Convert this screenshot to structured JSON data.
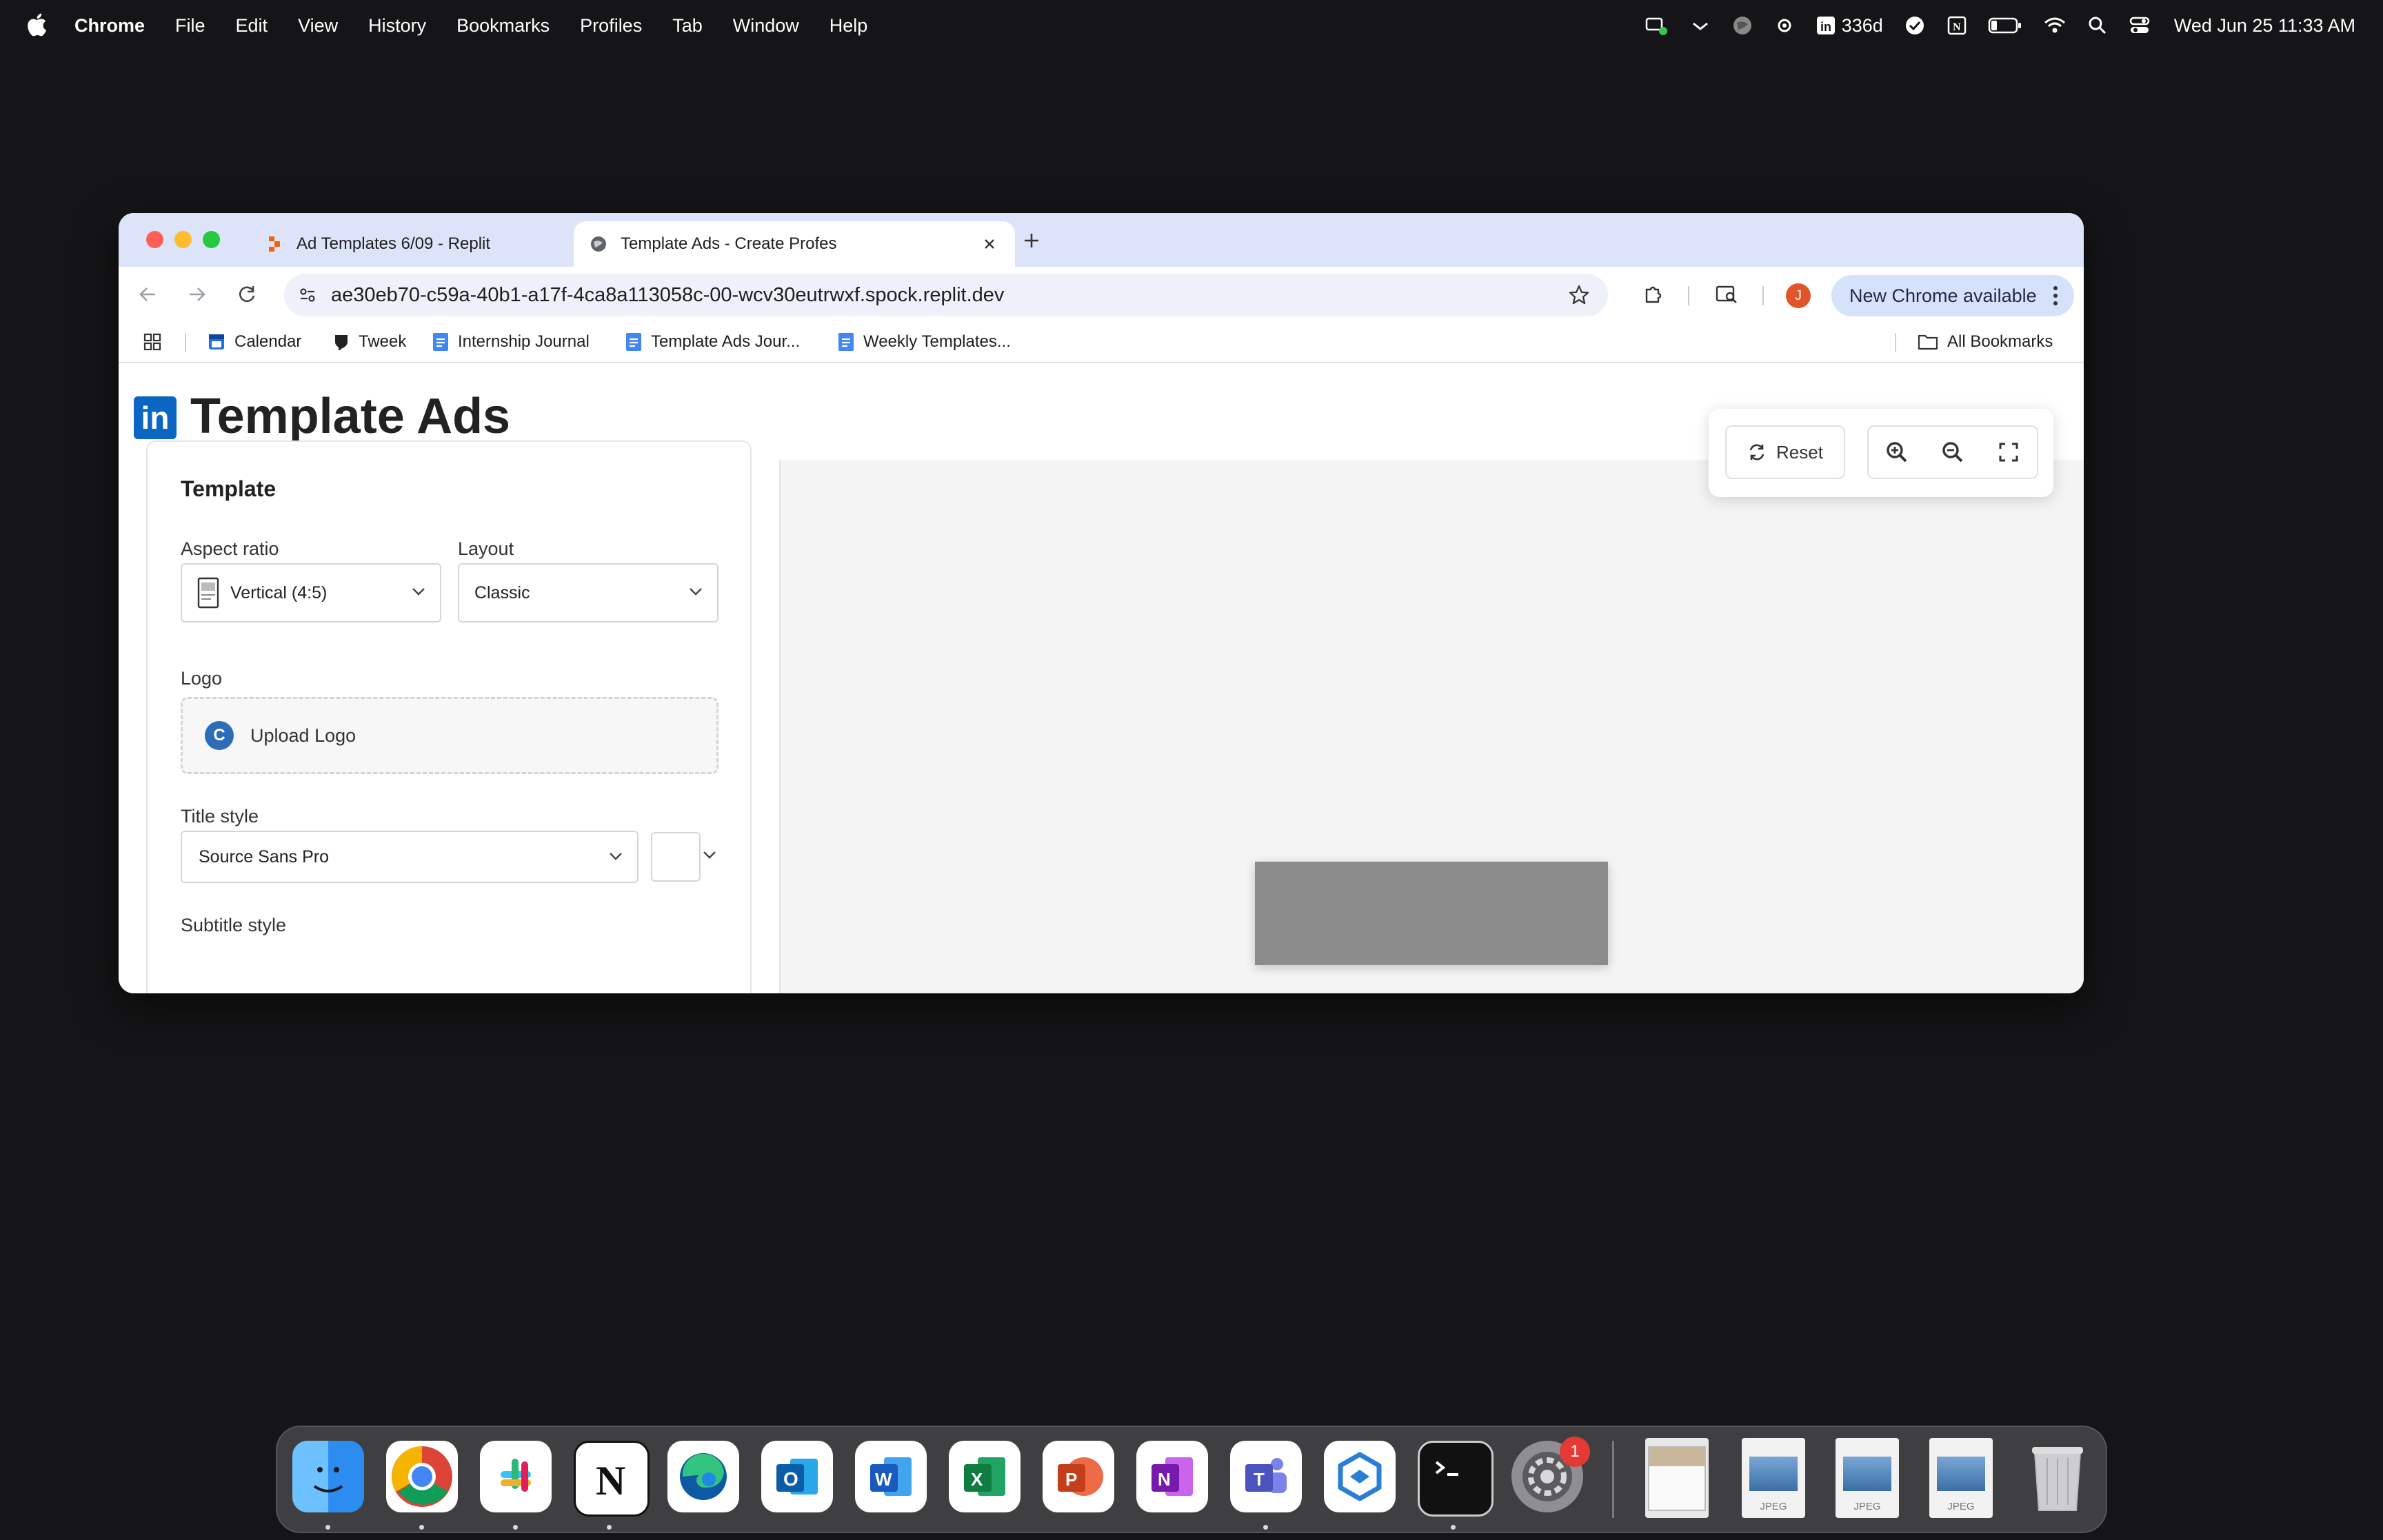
{
  "menubar": {
    "app": "Chrome",
    "items": [
      "File",
      "Edit",
      "View",
      "History",
      "Bookmarks",
      "Profiles",
      "Tab",
      "Window",
      "Help"
    ],
    "linkedin_streak": "336d",
    "clock": "Wed Jun 25  11:33 AM"
  },
  "tabs": [
    {
      "title": "Ad Templates 6/09 - Replit",
      "active": false
    },
    {
      "title": "Template Ads - Create Profes",
      "active": true
    }
  ],
  "omnibox": {
    "url": "ae30eb70-c59a-40b1-a17f-4ca8a113058c-00-wcv30eutrwxf.spock.replit.dev"
  },
  "profile": {
    "initial": "J"
  },
  "update_chip": {
    "label": "New Chrome available"
  },
  "bookmarks": {
    "items": [
      "Calendar",
      "Tweek",
      "Internship Journal",
      "Template Ads Jour...",
      "Weekly Templates..."
    ],
    "all_label": "All Bookmarks"
  },
  "page": {
    "title": "Template Ads",
    "logo_text": "in",
    "panel": {
      "heading": "Template",
      "aspect_label": "Aspect ratio",
      "aspect_value": "Vertical (4:5)",
      "layout_label": "Layout",
      "layout_value": "Classic",
      "logo_label": "Logo",
      "upload_label": "Upload Logo",
      "upload_icon_letter": "C",
      "title_style_label": "Title style",
      "title_font": "Source Sans Pro",
      "subtitle_style_label": "Subtitle style"
    },
    "toolbar": {
      "reset_label": "Reset"
    }
  },
  "dock": {
    "notification_badge": "1",
    "file_type": "JPEG"
  },
  "colors": {
    "linkedin_blue": "#0a66c2",
    "tab_strip": "#dde3f8",
    "preview_gray": "#8c8c8c"
  }
}
